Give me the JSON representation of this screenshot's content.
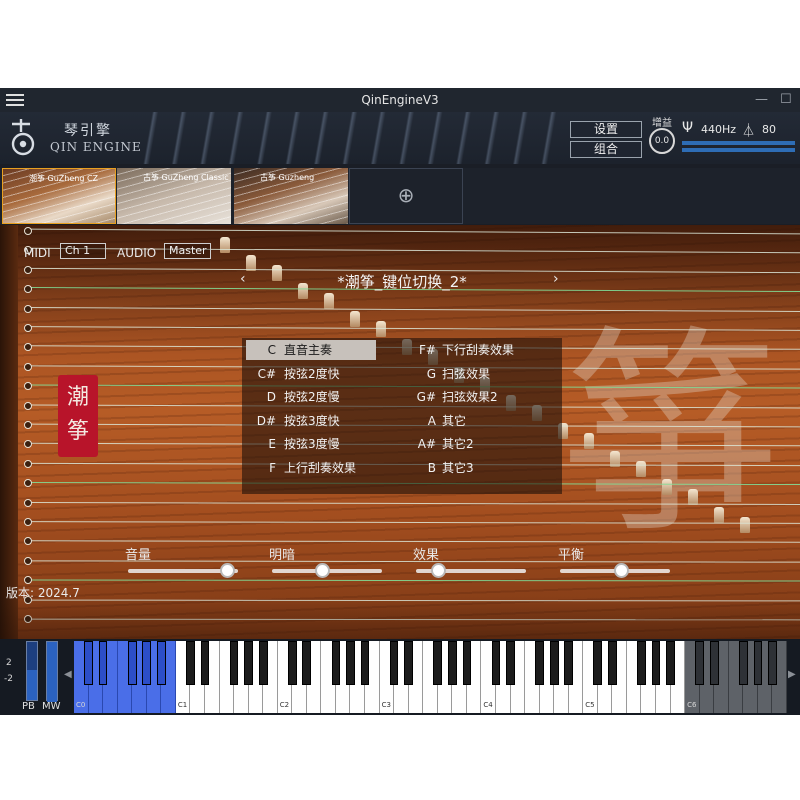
{
  "window": {
    "title": "QinEngineV3",
    "minimize": "—",
    "maximize": "☐"
  },
  "header": {
    "logo_cn": "琴引擎",
    "logo_en": "QIN ENGINE",
    "settings_button": "设置",
    "combo_button": "组合",
    "gain_label": "增益",
    "gain_value": "0.0",
    "tuning_value": "440Hz",
    "tempo_value": "80"
  },
  "presets": {
    "items": [
      {
        "label": "潮筝 GuZheng CZ",
        "selected": true
      },
      {
        "label": "古筝 GuZheng Classic",
        "selected": false
      },
      {
        "label": "古筝 Guzheng",
        "selected": false
      }
    ],
    "add_glyph": "⊕"
  },
  "routing": {
    "midi_label": "MIDI",
    "midi_channel": "Ch 1",
    "audio_label": "AUDIO",
    "audio_output": "Master"
  },
  "preset_nav": {
    "prev": "‹",
    "name": "*潮筝_键位切换_2*",
    "next": "›"
  },
  "seal_text": {
    "top": "潮",
    "bottom": "筝"
  },
  "background_glyph": "箏",
  "articulations": [
    {
      "key": "C",
      "label": "直音主奏",
      "selected": true
    },
    {
      "key": "C#",
      "label": "按弦2度快",
      "selected": false
    },
    {
      "key": "D",
      "label": "按弦2度慢",
      "selected": false
    },
    {
      "key": "D#",
      "label": "按弦3度快",
      "selected": false
    },
    {
      "key": "E",
      "label": "按弦3度慢",
      "selected": false
    },
    {
      "key": "F",
      "label": "上行刮奏效果",
      "selected": false
    },
    {
      "key": "F#",
      "label": "下行刮奏效果",
      "selected": false
    },
    {
      "key": "G",
      "label": "扫弦效果",
      "selected": false
    },
    {
      "key": "G#",
      "label": "扫弦效果2",
      "selected": false
    },
    {
      "key": "A",
      "label": "其它",
      "selected": false
    },
    {
      "key": "A#",
      "label": "其它2",
      "selected": false
    },
    {
      "key": "B",
      "label": "其它3",
      "selected": false
    }
  ],
  "params": [
    {
      "label": "音量",
      "value": 0.9
    },
    {
      "label": "明暗",
      "value": 0.45
    },
    {
      "label": "效果",
      "value": 0.2
    },
    {
      "label": "平衡",
      "value": 0.55
    }
  ],
  "version": "版本: 2024.7",
  "keyboard": {
    "pb_up": "2",
    "pb_down": "-2",
    "pb_label": "PB",
    "mw_label": "MW",
    "scroll_left": "◀",
    "scroll_right": "▶",
    "octaves": [
      "C0",
      "C1",
      "C2",
      "C3",
      "C4",
      "C5",
      "C6"
    ],
    "highlight_octave": "C0"
  },
  "colors": {
    "accent_blue": "#4a6ee8",
    "seal_red": "#b8142a",
    "selected_thumb_border": "#e8a020"
  },
  "icons": {
    "menu": "hamburger-icon",
    "tuning": "tuning-fork-icon",
    "tempo": "metronome-icon",
    "add": "plus-circle-icon"
  }
}
